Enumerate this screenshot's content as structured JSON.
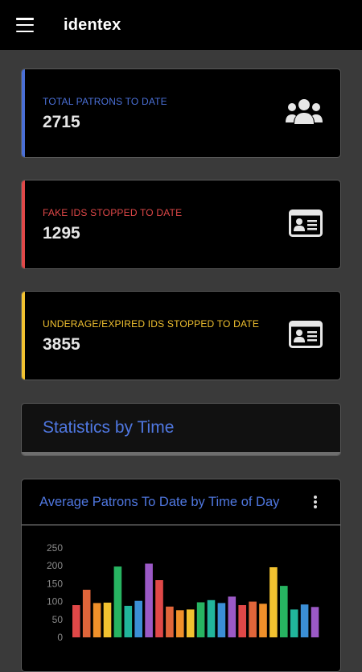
{
  "app": {
    "title": "identex"
  },
  "cards": [
    {
      "label": "TOTAL PATRONS TO DATE",
      "value": "2715",
      "accent": "#4a6fd6",
      "icon": "users-icon"
    },
    {
      "label": "FAKE IDS STOPPED TO DATE",
      "value": "1295",
      "accent": "#e04848",
      "icon": "id-card-icon"
    },
    {
      "label": "UNDERAGE/EXPIRED IDS STOPPED TO DATE",
      "value": "3855",
      "accent": "#f2c230",
      "icon": "id-card-icon"
    }
  ],
  "section": {
    "title": "Statistics by Time"
  },
  "chart_data": {
    "type": "bar",
    "title": "Average Patrons To Date by Time of Day",
    "xlabel": "",
    "ylabel": "",
    "ylim": [
      0,
      250
    ],
    "yticks": [
      "250",
      "200",
      "150",
      "100",
      "50",
      "0"
    ],
    "values": [
      90,
      133,
      96,
      97,
      198,
      88,
      102,
      206,
      160,
      86,
      76,
      78,
      98,
      104,
      96,
      114,
      90,
      100,
      94,
      196,
      144,
      78,
      92,
      85
    ],
    "colors": [
      "#e04848",
      "#e0653a",
      "#f0902a",
      "#f2c230",
      "#27b461",
      "#21b59b",
      "#3b8fd6",
      "#9b59c6",
      "#e04848",
      "#e0653a",
      "#f0902a",
      "#f2c230",
      "#27b461",
      "#21b59b",
      "#3b8fd6",
      "#9b59c6",
      "#e04848",
      "#e0653a",
      "#f0902a",
      "#f2c230",
      "#27b461",
      "#21b59b",
      "#3b8fd6",
      "#9b59c6"
    ]
  }
}
